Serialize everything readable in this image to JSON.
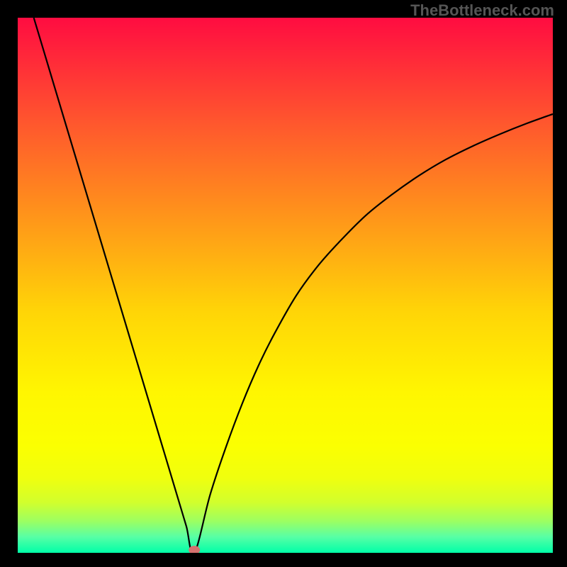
{
  "watermark": "TheBottleneck.com",
  "chart_data": {
    "type": "line",
    "title": "",
    "xlabel": "",
    "ylabel": "",
    "xlim": [
      0,
      100
    ],
    "ylim": [
      0,
      100
    ],
    "x": [
      3,
      6,
      9,
      12,
      15,
      18,
      21,
      24,
      27,
      30,
      31.5,
      33,
      36,
      39,
      42,
      45,
      48,
      52,
      56,
      60,
      65,
      70,
      75,
      80,
      85,
      90,
      95,
      100
    ],
    "y": [
      100,
      90,
      80,
      70,
      60,
      50,
      40,
      30,
      20,
      10,
      5,
      0,
      11,
      20,
      28,
      35,
      41,
      48,
      53.5,
      58,
      63,
      67,
      70.5,
      73.5,
      76,
      78.2,
      80.2,
      82
    ],
    "marker": {
      "x": 33,
      "y": 0,
      "color": "#d5726f"
    },
    "background_gradient": {
      "stops": [
        {
          "offset": 0.0,
          "color": "#ff0c41"
        },
        {
          "offset": 0.2,
          "color": "#ff582d"
        },
        {
          "offset": 0.4,
          "color": "#ff9f17"
        },
        {
          "offset": 0.55,
          "color": "#ffd507"
        },
        {
          "offset": 0.7,
          "color": "#fff601"
        },
        {
          "offset": 0.8,
          "color": "#fbff01"
        },
        {
          "offset": 0.86,
          "color": "#f0ff0e"
        },
        {
          "offset": 0.905,
          "color": "#d2ff2c"
        },
        {
          "offset": 0.94,
          "color": "#9eff60"
        },
        {
          "offset": 0.97,
          "color": "#58ffa5"
        },
        {
          "offset": 1.0,
          "color": "#00ffa8"
        }
      ]
    }
  }
}
